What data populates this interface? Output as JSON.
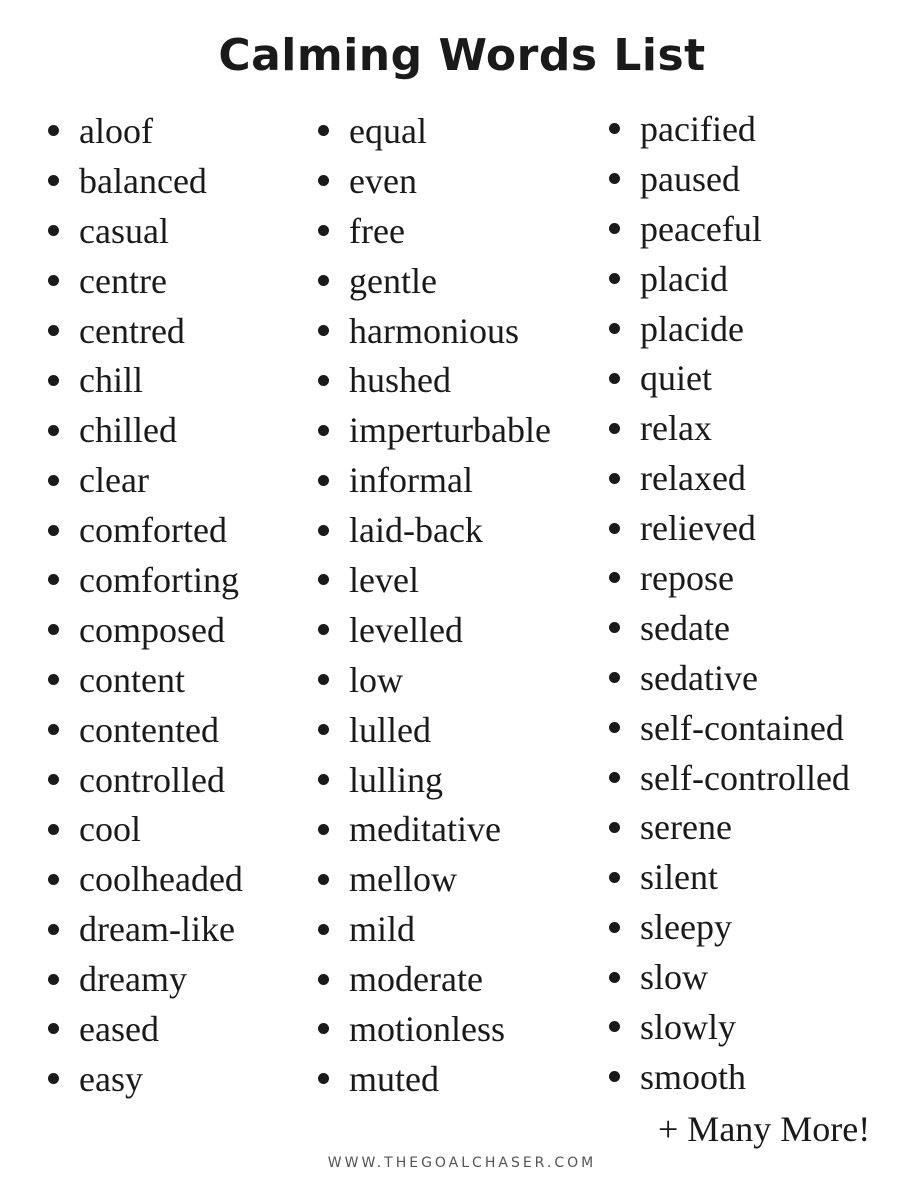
{
  "title": "Calming Words List",
  "columns": [
    [
      "aloof",
      "balanced",
      "casual",
      "centre",
      "centred",
      "chill",
      "chilled",
      "clear",
      "comforted",
      "comforting",
      "composed",
      "content",
      "contented",
      "controlled",
      "cool",
      "coolheaded",
      "dream-like",
      "dreamy",
      "eased",
      "easy"
    ],
    [
      "equal",
      "even",
      "free",
      "gentle",
      "harmonious",
      "hushed",
      "imperturbable",
      "informal",
      "laid-back",
      "level",
      "levelled",
      "low",
      "lulled",
      "lulling",
      "meditative",
      "mellow",
      "mild",
      "moderate",
      "motionless",
      "muted"
    ],
    [
      "pacified",
      "paused",
      "peaceful",
      "placid",
      "placide",
      "quiet",
      "relax",
      "relaxed",
      "relieved",
      "repose",
      "sedate",
      "sedative",
      "self-contained",
      "self-controlled",
      "serene",
      "silent",
      "sleepy",
      "slow",
      "slowly",
      "smooth"
    ]
  ],
  "more_label": "+ Many More!",
  "footer": "WWW.THEGOALCHASER.COM"
}
